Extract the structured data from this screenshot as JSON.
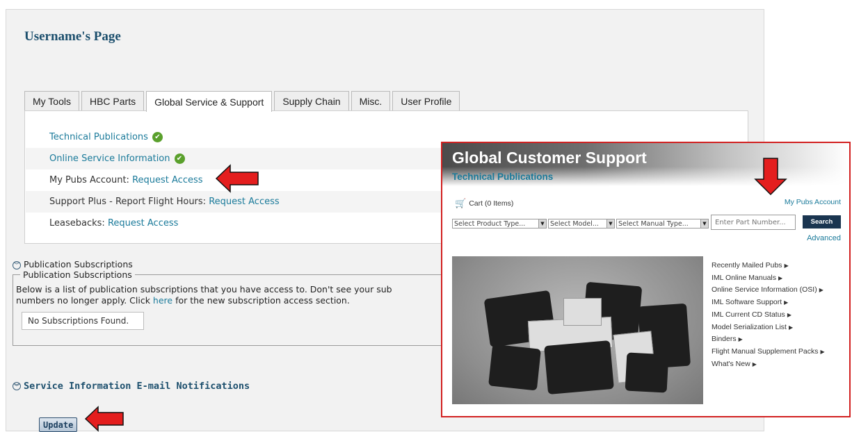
{
  "page": {
    "title": "Username's Page",
    "tabs": [
      {
        "label": "My Tools",
        "active": false
      },
      {
        "label": "HBC Parts",
        "active": false
      },
      {
        "label": "Global Service & Support",
        "active": true
      },
      {
        "label": "Supply Chain",
        "active": false
      },
      {
        "label": "Misc.",
        "active": false
      },
      {
        "label": "User Profile",
        "active": false
      }
    ],
    "tools": {
      "technical_publications": "Technical Publications",
      "online_service_information": "Online Service Information",
      "my_pubs_account_label": "My Pubs Account:",
      "my_pubs_account_link": "Request Access",
      "support_plus_label": "Support Plus - Report Flight Hours:",
      "support_plus_link": "Request Access",
      "leasebacks_label": "Leasebacks:",
      "leasebacks_link": "Request Access"
    },
    "subscriptions": {
      "header": "Publication Subscriptions",
      "legend": "Publication Subscriptions",
      "desc_line1": "Below is a list of publication subscriptions that you have access to. Don't see your sub",
      "desc_line2_pre": "numbers no longer apply. Click ",
      "desc_line2_link": "here",
      "desc_line2_post": " for the new subscription access section.",
      "empty_message": "No Subscriptions Found."
    },
    "notifications": {
      "header": "Service Information E-mail Notifications"
    },
    "update_button": "Update"
  },
  "overlay": {
    "title": "Global Customer Support",
    "subtitle": "Technical Publications",
    "cart": "Cart (0 Items)",
    "my_pubs_account": "My Pubs Account",
    "selects": [
      "Select Product Type...",
      "Select Model...",
      "Select Manual Type..."
    ],
    "part_number_placeholder": "Enter Part Number...",
    "search_button": "Search",
    "advanced": "Advanced",
    "links": [
      "Recently Mailed Pubs",
      "IML Online Manuals",
      "Online Service Information (OSI)",
      "IML Software Support",
      "IML Current CD Status",
      "Model Serialization List",
      "Binders",
      "Flight Manual Supplement Packs",
      "What's New"
    ]
  },
  "icons": {
    "check": "check-circle-icon",
    "expander": "expand-chevron-icon",
    "cart": "cart-icon",
    "arrow": "callout-arrow-icon"
  },
  "colors": {
    "link": "#1a7a9a",
    "heading": "#1c4f6d",
    "check": "#5aa02c",
    "arrow": "#e41e1e",
    "overlay_border": "#d21f1f",
    "search_button": "#1a3550"
  }
}
